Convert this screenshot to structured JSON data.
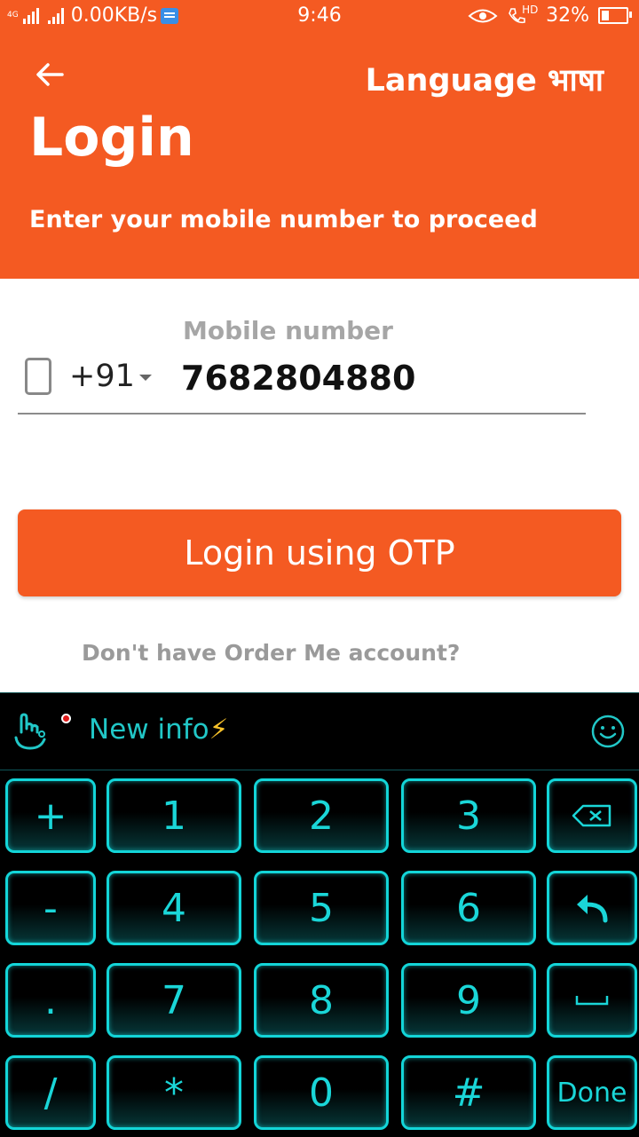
{
  "status_bar": {
    "network": "4G",
    "speed": "0.00KB/s",
    "time": "9:46",
    "hd": "HD",
    "battery_percent": "32%",
    "battery_level": 0.32
  },
  "header": {
    "language_label": "Language भाषा",
    "title": "Login",
    "subtitle": "Enter your mobile number to proceed"
  },
  "form": {
    "mobile_label": "Mobile number",
    "country_code": "+91",
    "mobile_value": "7682804880"
  },
  "login_button": "Login using OTP",
  "account_prompt": "Don't have Order Me account?",
  "keyboard": {
    "toolbar_text": "New info",
    "toolbar_emoji": "⚡",
    "rows": [
      [
        "+",
        "1",
        "2",
        "3",
        "backspace"
      ],
      [
        "-",
        "4",
        "5",
        "6",
        "enter"
      ],
      [
        ".",
        "7",
        "8",
        "9",
        "space"
      ],
      [
        "/",
        "*",
        "0",
        "#",
        "Done"
      ]
    ],
    "labels": {
      "plus": "+",
      "one": "1",
      "two": "2",
      "three": "3",
      "minus": "-",
      "four": "4",
      "five": "5",
      "six": "6",
      "dot": ".",
      "seven": "7",
      "eight": "8",
      "nine": "9",
      "slash": "/",
      "star": "*",
      "zero": "0",
      "hash": "#",
      "done": "Done"
    }
  },
  "colors": {
    "brand": "#f45a22",
    "keyboard_accent": "#13d5d8"
  }
}
